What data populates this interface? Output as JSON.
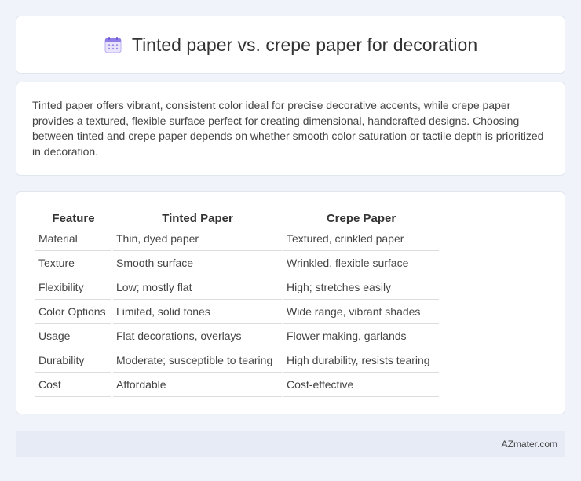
{
  "header": {
    "title": "Tinted paper vs. crepe paper for decoration",
    "icon": "calendar-icon"
  },
  "summary": {
    "text": "Tinted paper offers vibrant, consistent color ideal for precise decorative accents, while crepe paper provides a textured, flexible surface perfect for creating dimensional, handcrafted designs. Choosing between tinted and crepe paper depends on whether smooth color saturation or tactile depth is prioritized in decoration."
  },
  "table": {
    "headers": [
      "Feature",
      "Tinted Paper",
      "Crepe Paper"
    ],
    "rows": [
      [
        "Material",
        "Thin, dyed paper",
        "Textured, crinkled paper"
      ],
      [
        "Texture",
        "Smooth surface",
        "Wrinkled, flexible surface"
      ],
      [
        "Flexibility",
        "Low; mostly flat",
        "High; stretches easily"
      ],
      [
        "Color Options",
        "Limited, solid tones",
        "Wide range, vibrant shades"
      ],
      [
        "Usage",
        "Flat decorations, overlays",
        "Flower making, garlands"
      ],
      [
        "Durability",
        "Moderate; susceptible to tearing",
        "High durability, resists tearing"
      ],
      [
        "Cost",
        "Affordable",
        "Cost-effective"
      ]
    ]
  },
  "footer": {
    "brand": "AZmater.com"
  }
}
